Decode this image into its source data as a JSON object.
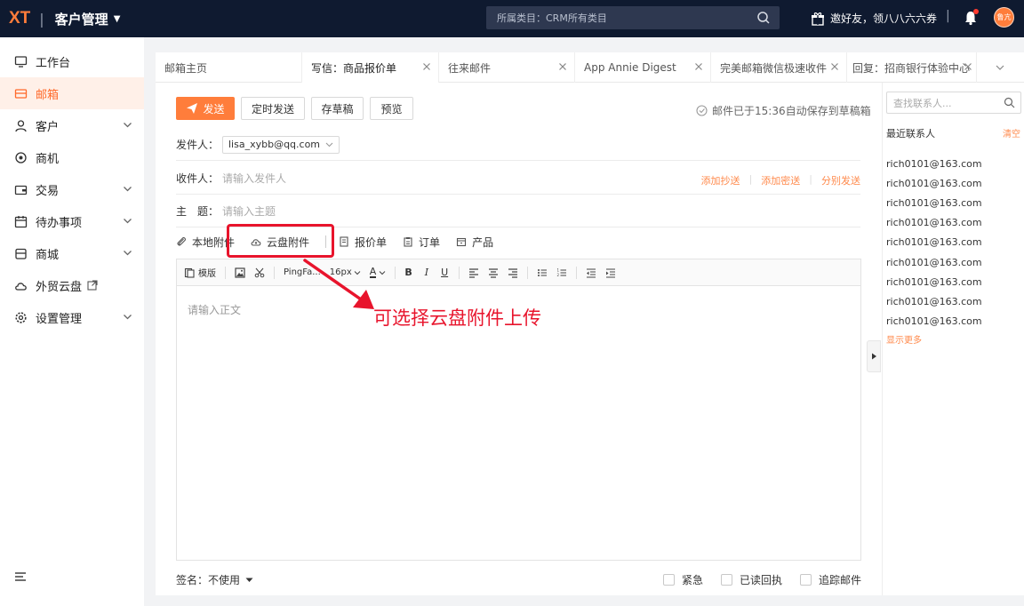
{
  "topbar": {
    "logo": "XT",
    "app_title": "客户管理",
    "search_placeholder": "所属类目：CRM所有类目",
    "invite_text": "邀好友，领八八六六券",
    "avatar_text": "鲁亢"
  },
  "sidebar": {
    "items": [
      {
        "label": "工作台",
        "icon": "monitor-icon",
        "has_chevron": false
      },
      {
        "label": "邮箱",
        "icon": "mail-icon",
        "has_chevron": false,
        "active": true
      },
      {
        "label": "客户",
        "icon": "user-icon",
        "has_chevron": true
      },
      {
        "label": "商机",
        "icon": "target-icon",
        "has_chevron": false
      },
      {
        "label": "交易",
        "icon": "wallet-icon",
        "has_chevron": true
      },
      {
        "label": "待办事项",
        "icon": "calendar-icon",
        "has_chevron": true
      },
      {
        "label": "商城",
        "icon": "store-icon",
        "has_chevron": true
      },
      {
        "label": "外贸云盘",
        "icon": "cloud-icon",
        "has_chevron": false
      },
      {
        "label": "设置管理",
        "icon": "settings-icon",
        "has_chevron": true
      }
    ]
  },
  "tabs": [
    {
      "label": "邮箱主页",
      "closable": false
    },
    {
      "label": "写信：商品报价单",
      "closable": true,
      "active": true
    },
    {
      "label": "往来邮件",
      "closable": true
    },
    {
      "label": "App Annie Digest",
      "closable": true
    },
    {
      "label": "完美邮箱微信极速收件",
      "closable": true
    },
    {
      "label": "回复：招商银行体验中心",
      "closable": true
    }
  ],
  "toolbar": {
    "send": "发送",
    "schedule": "定时发送",
    "draft": "存草稿",
    "preview": "预览",
    "autosave": "邮件已于15:36自动保存到草稿箱"
  },
  "fields": {
    "from_label": "发件人：",
    "from_value": "lisa_xybb@qq.com",
    "to_label": "收件人：",
    "to_placeholder": "请输入发件人",
    "cc": "添加抄送",
    "bcc": "添加密送",
    "separate": "分别发送",
    "subject_label": "主　题：",
    "subject_placeholder": "请输入主题"
  },
  "attachments": {
    "local": "本地附件",
    "cloud": "云盘附件",
    "quote": "报价单",
    "order": "订单",
    "product": "产品"
  },
  "editor": {
    "template": "模版",
    "font": "PingFa...",
    "size": "16px",
    "placeholder": "请输入正文"
  },
  "annotation": "可选择云盘附件上传",
  "footer": {
    "sign_label": "签名：",
    "sign_value": "不使用",
    "urgent": "紧急",
    "read_receipt": "已读回执",
    "track": "追踪邮件"
  },
  "contacts": {
    "search_placeholder": "查找联系人...",
    "recent_title": "最近联系人",
    "clear": "清空",
    "items": [
      "rich0101@163.com",
      "rich0101@163.com",
      "rich0101@163.com",
      "rich0101@163.com",
      "rich0101@163.com",
      "rich0101@163.com",
      "rich0101@163.com",
      "rich0101@163.com",
      "rich0101@163.com"
    ],
    "show_more": "显示更多"
  }
}
